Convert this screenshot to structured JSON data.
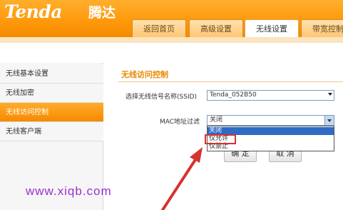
{
  "brand": {
    "logo": "Tenda",
    "logo_cn": "腾达"
  },
  "tabs": [
    {
      "label": "返回首页"
    },
    {
      "label": "高级设置"
    },
    {
      "label": "无线设置"
    },
    {
      "label": "带宽控制"
    }
  ],
  "sidebar": {
    "items": [
      {
        "label": "无线基本设置"
      },
      {
        "label": "无线加密"
      },
      {
        "label": "无线访问控制"
      },
      {
        "label": "无线客户端"
      }
    ]
  },
  "main": {
    "title": "无线访问控制",
    "ssid_label": "选择无线信号名称(SSID)",
    "ssid_value": "Tenda_052B50",
    "mac_label": "MAC地址过滤",
    "mac_value": "关闭",
    "mac_options": [
      "关闭",
      "仅允许",
      "仅禁止"
    ],
    "confirm": "确 定",
    "cancel": "取 消"
  },
  "watermark": "www.xiqb.com",
  "colors": {
    "accent": "#f79300",
    "highlight": "#316ac5",
    "annotation": "#d8322f",
    "watermark": "#9b2fd0"
  }
}
